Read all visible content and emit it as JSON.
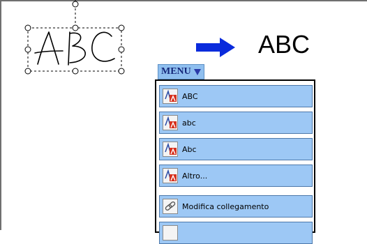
{
  "recognized_text": "ABC",
  "menu": {
    "tab_label": "MENU",
    "items": [
      {
        "label": "ABC",
        "icon": "recognize-text-icon"
      },
      {
        "label": "abc",
        "icon": "recognize-text-icon"
      },
      {
        "label": "Abc",
        "icon": "recognize-text-icon"
      },
      {
        "label": "Altro...",
        "icon": "recognize-text-icon"
      },
      {
        "label": "Modifica collegamento",
        "icon": "link-icon"
      },
      {
        "label": "",
        "icon": "item-icon"
      }
    ]
  },
  "colors": {
    "arrow": "#0a2bdc",
    "menu_item_bg": "#9dc8f5",
    "menu_tab_text": "#15287a"
  }
}
